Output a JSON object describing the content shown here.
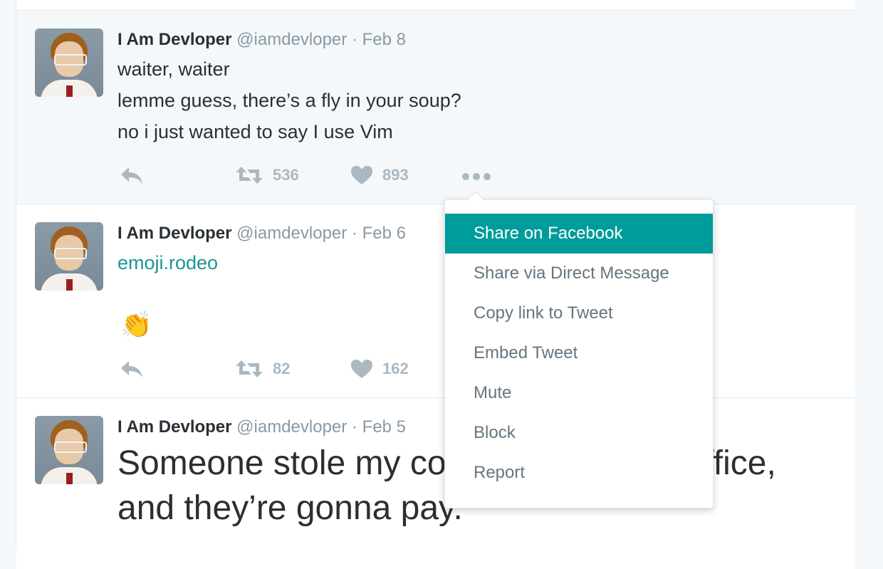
{
  "tweets": [
    {
      "name": "I Am Devloper",
      "handle": "@iamdevloper",
      "separator": "·",
      "date": "Feb 8",
      "lines": [
        "waiter, waiter",
        "lemme guess, there’s a fly in your soup?",
        "no i just wanted to say I use Vim"
      ],
      "retweets": "536",
      "likes": "893"
    },
    {
      "name": "I Am Devloper",
      "handle": "@iamdevloper",
      "separator": "·",
      "date": "Feb 6",
      "link": "emoji.rodeo",
      "emoji": "👏",
      "retweets": "82",
      "likes": "162"
    },
    {
      "name": "I Am Devloper",
      "handle": "@iamdevloper",
      "separator": "·",
      "date": "Feb 5",
      "lines": [
        "Someone stole my copy of Microsoft Office,",
        "and they’re gonna pay."
      ]
    }
  ],
  "dropdown": {
    "items": [
      "Share on Facebook",
      "Share via Direct Message",
      "Copy link to Tweet",
      "Embed Tweet",
      "Mute",
      "Block",
      "Report"
    ],
    "active_index": 0
  },
  "icons": {
    "reply": "reply-icon",
    "retweet": "retweet-icon",
    "like": "heart-icon",
    "more": "more-dots-icon"
  },
  "colors": {
    "accent": "#009b9b",
    "link": "#1b9595",
    "muted": "#8899a6",
    "action_icons": "#aab8c2"
  }
}
